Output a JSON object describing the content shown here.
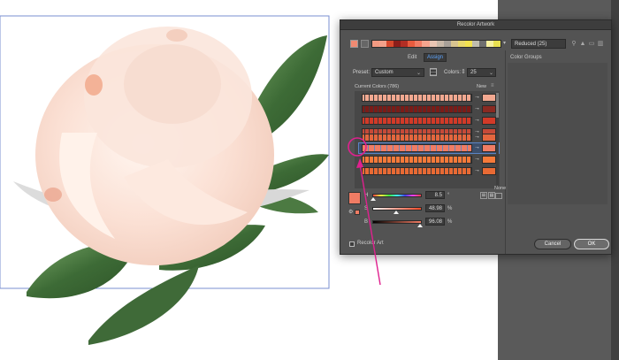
{
  "dialog": {
    "title": "Recolor Artwork",
    "tabs": {
      "edit": "Edit",
      "assign": "Assign"
    },
    "harmony": {
      "name": "Reduced (25)",
      "swatches": [
        "#f29a82",
        "#f3a18a",
        "#d6482c",
        "#8c1e1a",
        "#b22e24",
        "#e85b3e",
        "#f07c64",
        "#f5a48e",
        "#e9c5b3",
        "#c8b8a8",
        "#a8a098",
        "#d8c490",
        "#e9d86c",
        "#f2e24f",
        "#bfbcae",
        "#6f6f6f",
        "#f7f0a0",
        "#e8e050"
      ]
    },
    "preset": {
      "label": "Preset:",
      "value": "Custom"
    },
    "colors": {
      "label": "Colors:",
      "value": "25"
    },
    "color_groups_label": "Color Groups",
    "current_colors_label": "Current Colors (786)",
    "new_label": "New",
    "arrow_glyph": "→",
    "rows": [
      {
        "bar": "#f2a890",
        "new": "#f2a890"
      },
      {
        "bar": "#7a1c18",
        "new": "#8a2a22"
      },
      {
        "bar": "#d23a28",
        "new": "#d23a28"
      },
      {
        "bar": "#c64a38",
        "new": "#c64a38"
      },
      {
        "bar": "#e4663e",
        "new": "#e4663e"
      },
      {
        "bar": "#f07c64",
        "new": "#f07c64"
      },
      {
        "bar": "#f57a3a",
        "new": "#f57a3a"
      },
      {
        "bar": "#e86a34",
        "new": "#e86a34"
      }
    ],
    "sliders": [
      {
        "label": "H",
        "value": "8.5",
        "unit": "°",
        "level": 0.02,
        "gradient": "linear-gradient(90deg,#ff4040,#ffff40,#40ff40,#40ffff,#4040ff,#ff40ff,#ff4040)"
      },
      {
        "label": "S",
        "value": "48.98",
        "unit": "%",
        "level": 0.49,
        "gradient": "linear-gradient(90deg,#f5f5f5,#f24a28)"
      },
      {
        "label": "B",
        "value": "96.08",
        "unit": "%",
        "level": 0.96,
        "gradient": "linear-gradient(90deg,#000000,#f07c64)"
      }
    ],
    "none_label": "None",
    "recolor_art_label": "Recolor Art",
    "buttons": {
      "cancel": "Cancel",
      "ok": "OK"
    }
  },
  "colors": {
    "accent": "#5ea6ff",
    "annotation": "#e0208f",
    "dialog_bg": "#535353",
    "gray_panel": "#5a5a5a"
  }
}
